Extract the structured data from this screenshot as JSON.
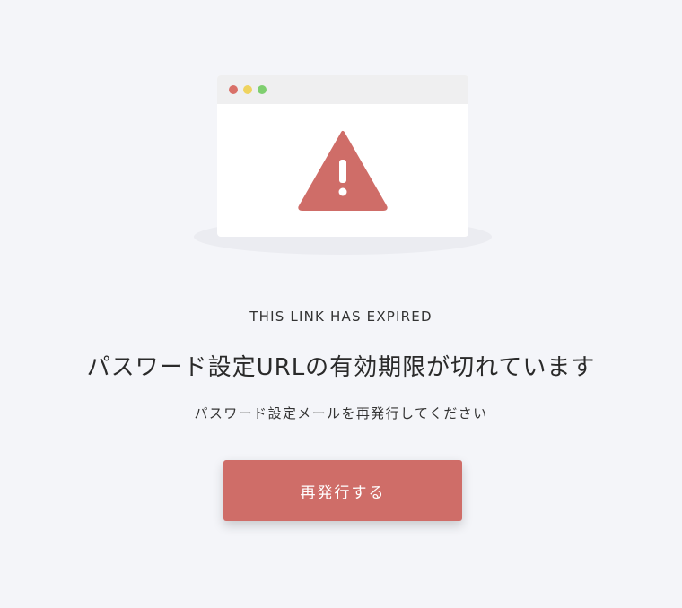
{
  "illustration": {
    "icon": "warning-triangle-icon",
    "accent_color": "#cf6d68",
    "window_dots": [
      "#d97068",
      "#efd35f",
      "#7fcf6f"
    ]
  },
  "message": {
    "eyebrow": "THIS LINK HAS EXPIRED",
    "title": "パスワード設定URLの有効期限が切れています",
    "subtitle": "パスワード設定メールを再発行してください"
  },
  "actions": {
    "reissue_label": "再発行する"
  },
  "colors": {
    "background": "#f4f5f9",
    "button": "#cf6d68",
    "button_text": "#ffffff"
  }
}
